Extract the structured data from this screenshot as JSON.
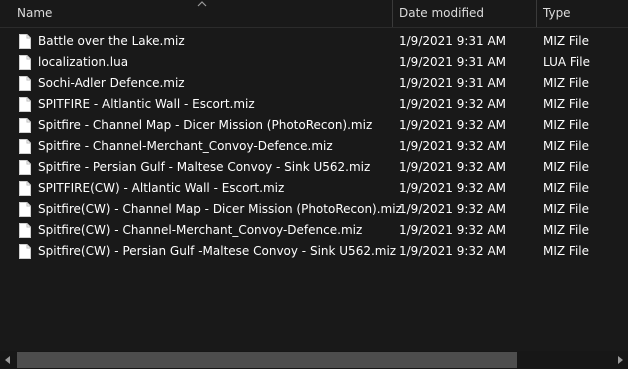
{
  "columns": {
    "name": "Name",
    "date_modified": "Date modified",
    "type": "Type"
  },
  "sort": {
    "column": "name",
    "icon": "chevron-up-icon"
  },
  "files": [
    {
      "name": "Battle over the Lake.miz",
      "date": "1/9/2021 9:31 AM",
      "type": "MIZ File"
    },
    {
      "name": "localization.lua",
      "date": "1/9/2021 9:31 AM",
      "type": "LUA File"
    },
    {
      "name": "Sochi-Adler Defence.miz",
      "date": "1/9/2021 9:31 AM",
      "type": "MIZ File"
    },
    {
      "name": "SPITFIRE - Altlantic Wall - Escort.miz",
      "date": "1/9/2021 9:32 AM",
      "type": "MIZ File"
    },
    {
      "name": "Spitfire - Channel Map - Dicer Mission (PhotoRecon).miz",
      "date": "1/9/2021 9:32 AM",
      "type": "MIZ File"
    },
    {
      "name": "Spitfire - Channel-Merchant_Convoy-Defence.miz",
      "date": "1/9/2021 9:32 AM",
      "type": "MIZ File"
    },
    {
      "name": "Spitfire - Persian Gulf - Maltese Convoy - Sink U562.miz",
      "date": "1/9/2021 9:32 AM",
      "type": "MIZ File"
    },
    {
      "name": "SPITFIRE(CW) - Altlantic Wall - Escort.miz",
      "date": "1/9/2021 9:32 AM",
      "type": "MIZ File"
    },
    {
      "name": "Spitfire(CW) - Channel Map - Dicer Mission (PhotoRecon).miz",
      "date": "1/9/2021 9:32 AM",
      "type": "MIZ File"
    },
    {
      "name": "Spitfire(CW) - Channel-Merchant_Convoy-Defence.miz",
      "date": "1/9/2021 9:32 AM",
      "type": "MIZ File"
    },
    {
      "name": "Spitfire(CW) - Persian Gulf -Maltese Convoy - Sink U562.miz",
      "date": "1/9/2021 9:32 AM",
      "type": "MIZ File"
    }
  ],
  "file_icon": "document-icon",
  "colors": {
    "background": "#191919",
    "text": "#ffffff",
    "scroll_thumb": "#4d4d4d"
  }
}
